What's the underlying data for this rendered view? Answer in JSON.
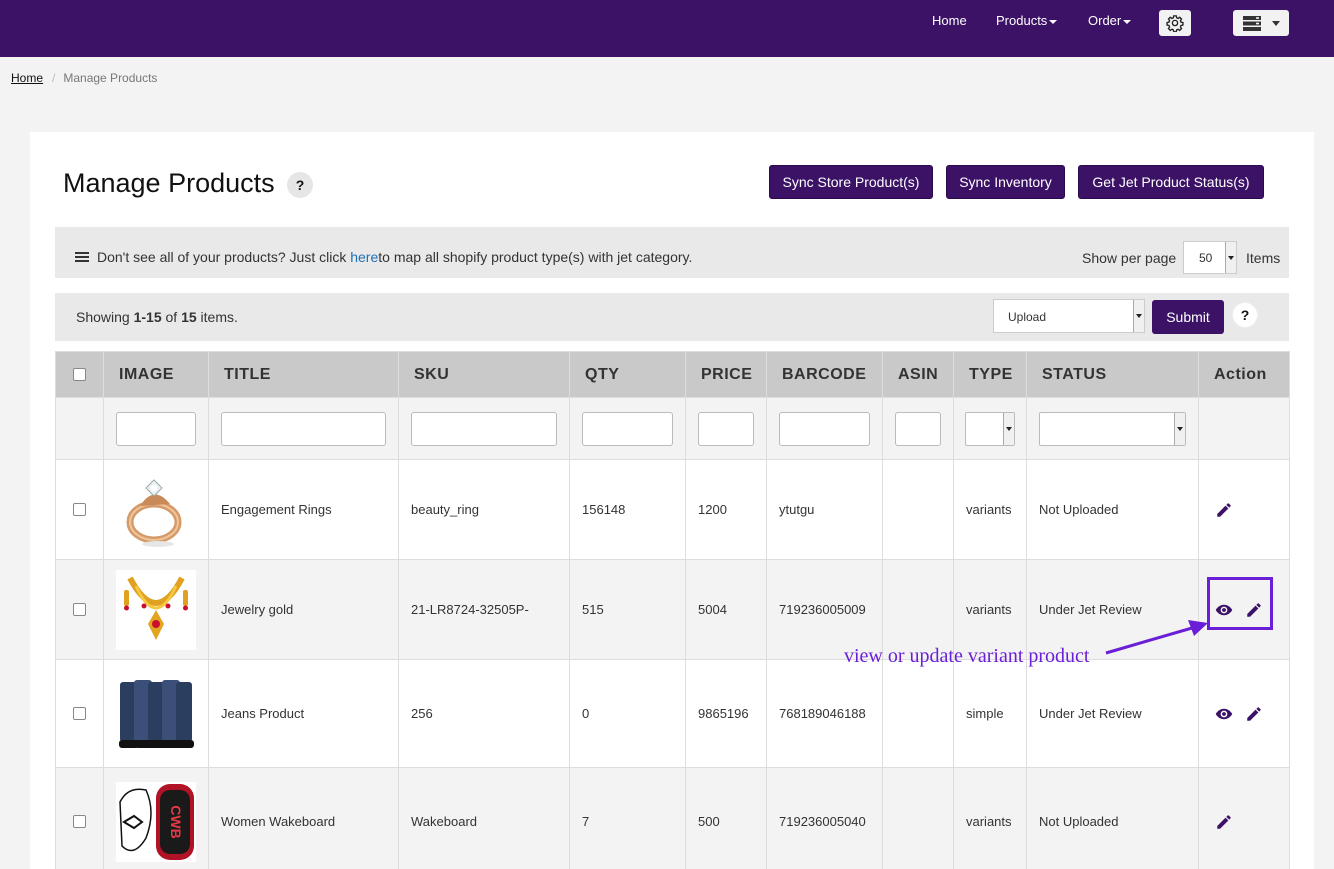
{
  "nav": {
    "home": "Home",
    "products": "Products",
    "order": "Order"
  },
  "breadcrumb": {
    "home": "Home",
    "current": "Manage Products"
  },
  "page": {
    "title": "Manage Products",
    "help": "?"
  },
  "buttons": {
    "sync_store": "Sync Store Product(s)",
    "sync_inventory": "Sync Inventory",
    "jet_status": "Get Jet Product Status(s)"
  },
  "info": {
    "text_before": "Don't see all of your products? Just click ",
    "link": "here",
    "text_after": " to map all shopify product type(s) with jet category."
  },
  "pagination": {
    "show_per_page": "Show per page",
    "per_page_value": "50",
    "items_label": "Items"
  },
  "summary": {
    "prefix": "Showing ",
    "range": "1-15",
    "of": " of ",
    "total": "15",
    "suffix": " items."
  },
  "bulk": {
    "action_value": "Upload",
    "submit": "Submit",
    "help": "?"
  },
  "table": {
    "headers": [
      "IMAGE",
      "TITLE",
      "SKU",
      "QTY",
      "PRICE",
      "BARCODE",
      "ASIN",
      "TYPE",
      "STATUS",
      "Action"
    ],
    "rows": [
      {
        "title": "Engagement Rings",
        "sku": "beauty_ring",
        "qty": "156148",
        "price": "1200",
        "barcode": "ytutgu",
        "asin": "",
        "type": "variants",
        "status": "Not Uploaded",
        "image": "ring-image",
        "actions": [
          "edit"
        ]
      },
      {
        "title": "Jewelry gold",
        "sku": "21-LR8724-32505P-",
        "qty": "515",
        "price": "5004",
        "barcode": "719236005009",
        "asin": "",
        "type": "variants",
        "status": "Under Jet Review",
        "image": "necklace-image",
        "actions": [
          "view",
          "edit"
        ]
      },
      {
        "title": "Jeans Product",
        "sku": "256",
        "qty": "0",
        "price": "9865196",
        "barcode": "768189046188",
        "asin": "",
        "type": "simple",
        "status": "Under Jet Review",
        "image": "jeans-image",
        "actions": [
          "view",
          "edit"
        ]
      },
      {
        "title": "Women Wakeboard",
        "sku": "Wakeboard",
        "qty": "7",
        "price": "500",
        "barcode": "719236005040",
        "asin": "",
        "type": "variants",
        "status": "Not Uploaded",
        "image": "wakeboard-image",
        "actions": [
          "edit"
        ]
      }
    ]
  },
  "annotation": {
    "text": "view or update variant product"
  },
  "colors": {
    "brand": "#3c1266",
    "annotation": "#6a1fd6",
    "link": "#1e70b8"
  }
}
